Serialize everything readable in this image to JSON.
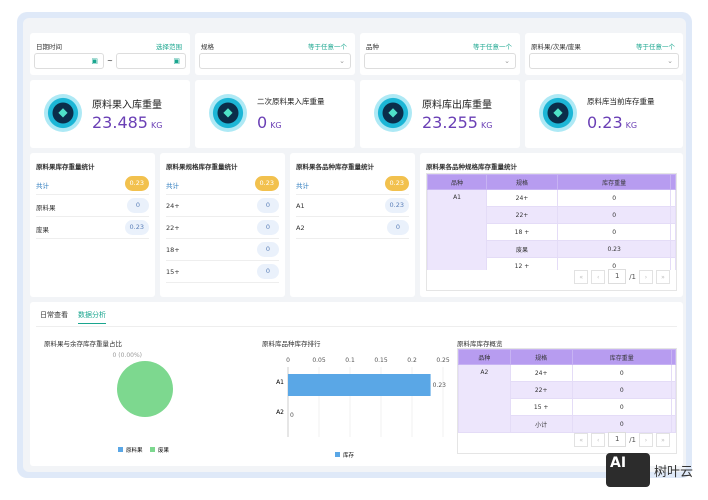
{
  "filters": [
    {
      "label": "日期时间",
      "operator": "选择范围",
      "separator": "~"
    },
    {
      "label": "规格",
      "operator": "等于任意一个"
    },
    {
      "label": "品种",
      "operator": "等于任意一个"
    },
    {
      "label": "原料果/次果/废果",
      "operator": "等于任意一个"
    }
  ],
  "kpis": [
    {
      "title": "原料果入库重量",
      "value": "23.485",
      "unit": "KG"
    },
    {
      "title": "二次原料果入库重量",
      "value": "0",
      "unit": "KG"
    },
    {
      "title": "原料库出库重量",
      "value": "23.255",
      "unit": "KG"
    },
    {
      "title": "原料库当前库存重量",
      "value": "0.23",
      "unit": "KG"
    }
  ],
  "stats": [
    {
      "title": "原料果库存重量统计",
      "rows": [
        {
          "label": "共计",
          "value": "0.23"
        },
        {
          "label": "原料果",
          "value": "0"
        },
        {
          "label": "废果",
          "value": "0.23"
        }
      ]
    },
    {
      "title": "原料果规格库存重量统计",
      "rows": [
        {
          "label": "共计",
          "value": "0.23"
        },
        {
          "label": "24+",
          "value": "0"
        },
        {
          "label": "22+",
          "value": "0"
        },
        {
          "label": "18+",
          "value": "0"
        },
        {
          "label": "15+",
          "value": "0"
        }
      ]
    },
    {
      "title": "原料果各品种库存重量统计",
      "rows": [
        {
          "label": "共计",
          "value": "0.23"
        },
        {
          "label": "A1",
          "value": "0.23"
        },
        {
          "label": "A2",
          "value": "0"
        }
      ]
    }
  ],
  "table1": {
    "title": "原料果各品种规格库存重量统计",
    "headers": [
      "品种",
      "规格",
      "库存重量",
      ""
    ],
    "group": "A1",
    "rows": [
      [
        "24+",
        "0"
      ],
      [
        "22+",
        "0"
      ],
      [
        "18 +",
        "0"
      ],
      [
        "废果",
        "0.23"
      ],
      [
        "12 +",
        "0"
      ]
    ],
    "page": "1",
    "total_pages": "/1"
  },
  "tabs": [
    {
      "label": "日常查看",
      "active": false
    },
    {
      "label": "数据分析",
      "active": true
    }
  ],
  "chart_data": [
    {
      "type": "pie",
      "title": "原料果与余存库存重量占比",
      "categories": [
        "原料果",
        "废果"
      ],
      "values": [
        0,
        0.23
      ],
      "colors": [
        "#5aa7e6",
        "#7dd88f"
      ],
      "annotation": "0 (0.00%)",
      "legend": "bottom"
    },
    {
      "type": "bar",
      "orientation": "horizontal",
      "title": "原料库品种库存排行",
      "categories": [
        "A1",
        "A2"
      ],
      "series": [
        {
          "name": "库存",
          "values": [
            0.23,
            0
          ]
        }
      ],
      "xlim": [
        0,
        0.25
      ],
      "xticks": [
        "0",
        "0.05",
        "0.1",
        "0.15",
        "0.2",
        "0.25"
      ],
      "data_labels": [
        "0.23",
        "0"
      ],
      "color": "#5aa7e6",
      "legend": "bottom"
    }
  ],
  "table2": {
    "title": "原料库库存概览",
    "headers": [
      "品种",
      "规格",
      "库存重量",
      ""
    ],
    "group": "A2",
    "rows": [
      [
        "24+",
        "0"
      ],
      [
        "22+",
        "0"
      ],
      [
        "15 +",
        "0"
      ],
      [
        "小计",
        "0"
      ]
    ],
    "page": "1",
    "total_pages": "/1"
  },
  "watermark": {
    "logo": "AI",
    "text": "树叶云"
  }
}
